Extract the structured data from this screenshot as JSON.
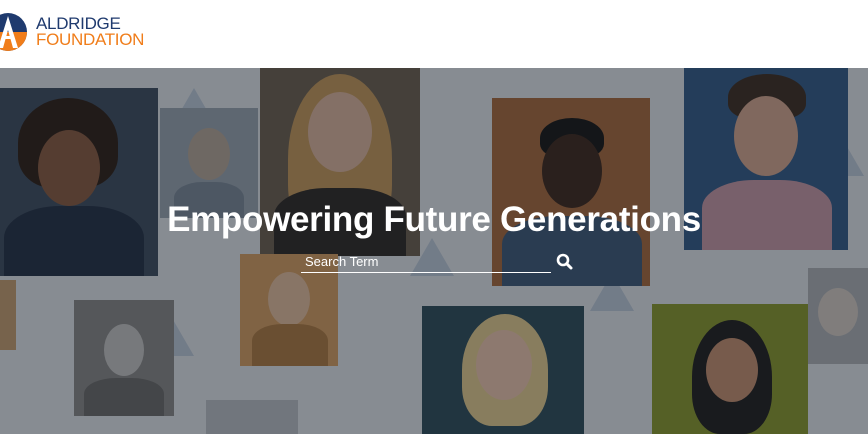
{
  "brand": {
    "name_line1": "ALDRIDGE",
    "name_line2": "FOUNDATION",
    "primary_color": "#1f3a6e",
    "accent_color": "#f07d1a"
  },
  "hero": {
    "title": "Empowering Future Generations",
    "overlay_color": "rgba(25,28,35,0.46)",
    "background_color": "#e6ebf1"
  },
  "search": {
    "placeholder": "Search Term",
    "value": "",
    "button_icon": "search-icon"
  }
}
